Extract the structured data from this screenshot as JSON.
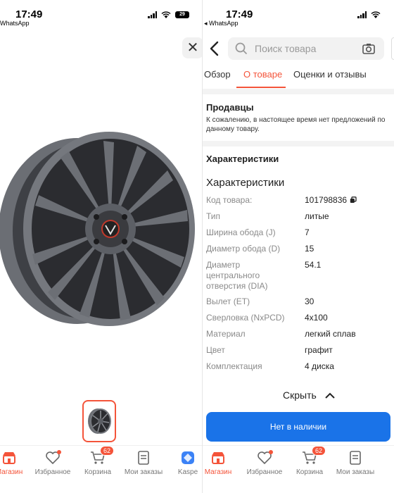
{
  "status_left": {
    "time": "17:49",
    "back_app": "WhatsApp",
    "battery": "29"
  },
  "status_right": {
    "time": "17:49",
    "back_app": "◂ WhatsApp"
  },
  "colors": {
    "accent": "#f4543a",
    "primary_button": "#1a73e8",
    "wheel": "#5a5d63"
  },
  "gallery": {
    "close_icon": "close-icon",
    "main_image": "alloy-wheel",
    "thumbnail": "alloy-wheel-thumbnail"
  },
  "header": {
    "search_placeholder": "Поиск товара"
  },
  "tabs": [
    {
      "label": "Обзор",
      "active": false
    },
    {
      "label": "О товаре",
      "active": true
    },
    {
      "label": "Оценки и отзывы",
      "active": false
    }
  ],
  "sellers": {
    "title": "Продавцы",
    "message": "К сожалению, в настоящее время нет предложений по данному товару."
  },
  "characteristics": {
    "section_title": "Характеристики",
    "subtitle": "Характеристики",
    "rows": [
      {
        "label": "Код товара:",
        "value": "101798836"
      },
      {
        "label": "Тип",
        "value": "литые"
      },
      {
        "label": "Ширина обода (J)",
        "value": "7"
      },
      {
        "label": "Диаметр обода (D)",
        "value": "15"
      },
      {
        "label": "Диаметр центрального отверстия (DIA)",
        "value": "54.1"
      },
      {
        "label": "Вылет (ET)",
        "value": "30"
      },
      {
        "label": "Сверловка (NxPCD)",
        "value": "4x100"
      },
      {
        "label": "Материал",
        "value": "легкий сплав"
      },
      {
        "label": "Цвет",
        "value": "графит"
      },
      {
        "label": "Комплектация",
        "value": "4 диска"
      }
    ],
    "hide_label": "Скрыть"
  },
  "availability_button": "Нет в наличии",
  "bottom_nav_left": [
    {
      "label": "Магазин",
      "icon": "shop-icon",
      "active": true
    },
    {
      "label": "Избранное",
      "icon": "heart-icon",
      "active": false
    },
    {
      "label": "Корзина",
      "icon": "cart-icon",
      "active": false,
      "badge": "62"
    },
    {
      "label": "Мои заказы",
      "icon": "orders-icon",
      "active": false
    },
    {
      "label": "Kaspe",
      "icon": "kaspi-icon",
      "active": false
    }
  ],
  "bottom_nav_right": [
    {
      "label": "Магазин",
      "icon": "shop-icon",
      "active": true
    },
    {
      "label": "Избранное",
      "icon": "heart-icon",
      "active": false
    },
    {
      "label": "Корзина",
      "icon": "cart-icon",
      "active": false,
      "badge": "62"
    },
    {
      "label": "Мои заказы",
      "icon": "orders-icon",
      "active": false
    }
  ]
}
